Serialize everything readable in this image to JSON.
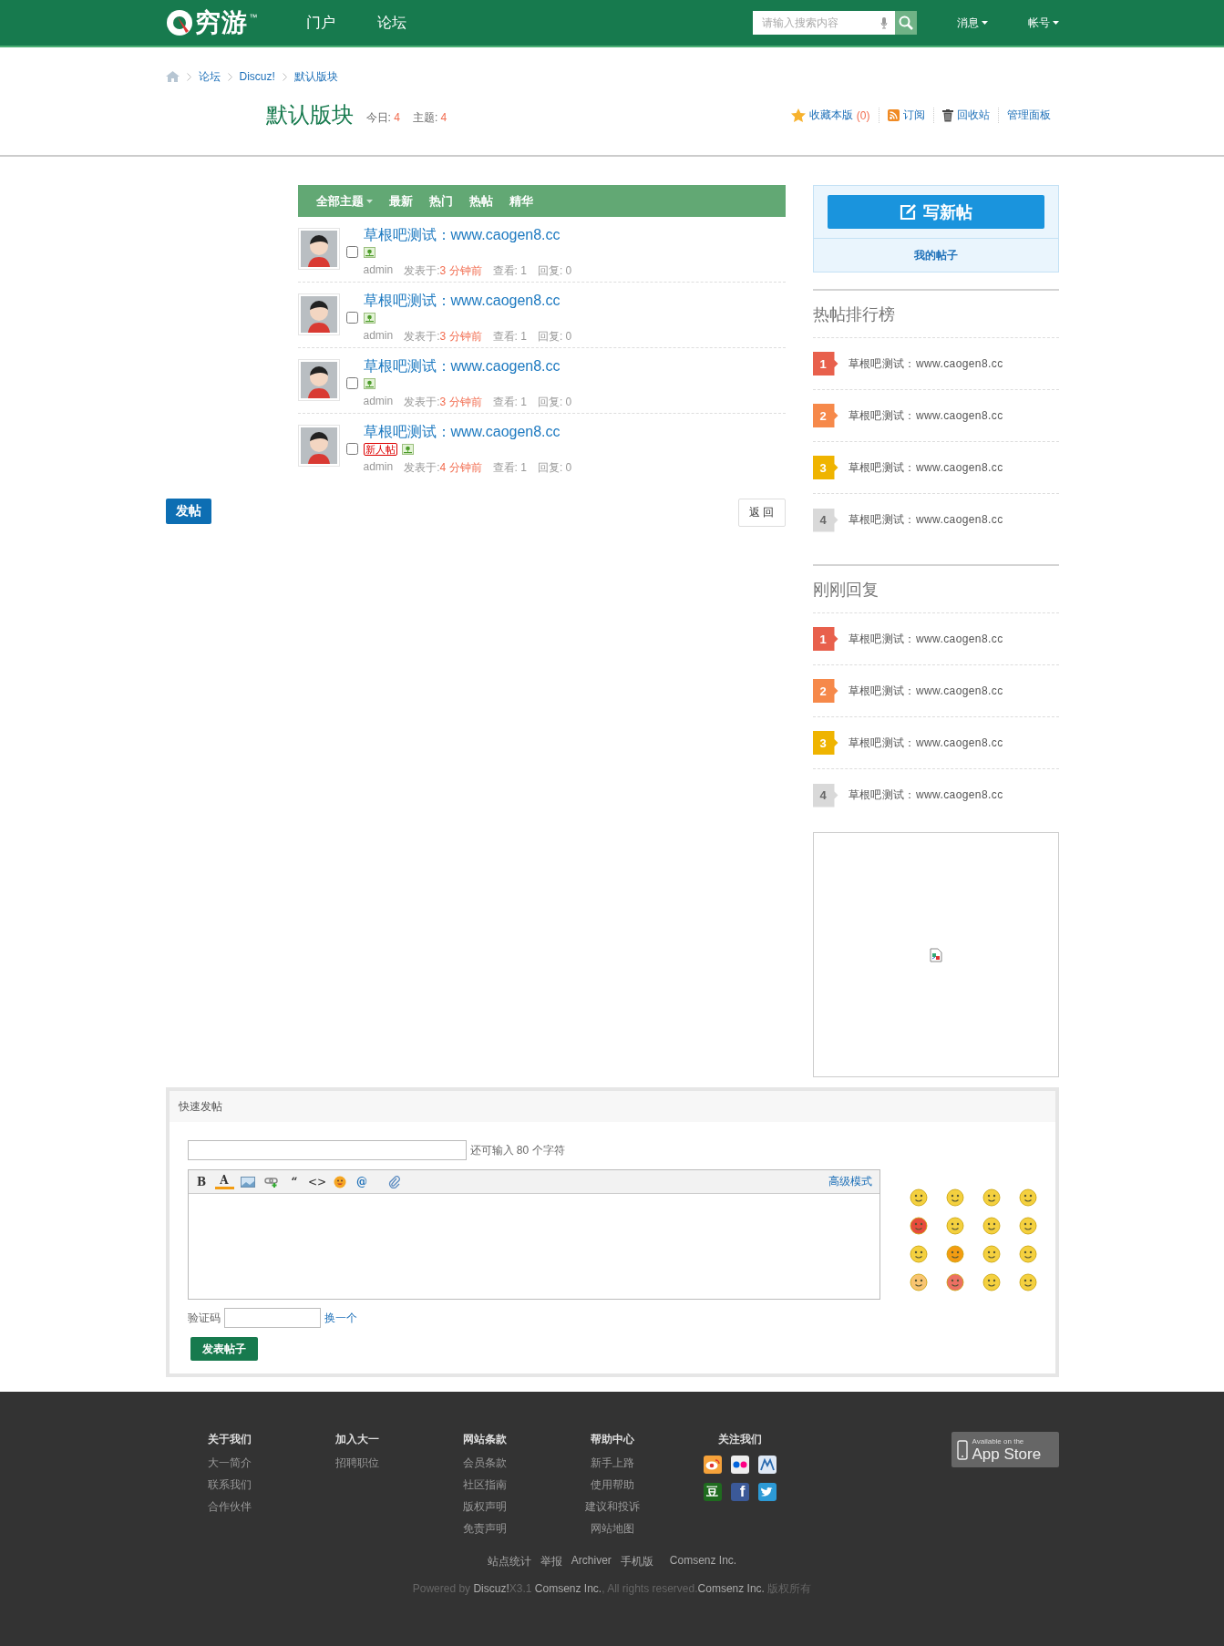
{
  "header": {
    "logo": "穷游",
    "logo_mark": "™",
    "nav": [
      "门户",
      "论坛"
    ],
    "search": {
      "placeholder": "请输入搜索内容"
    },
    "user_menu": [
      "消息",
      "帐号"
    ]
  },
  "breadcrumb": [
    "论坛",
    "Discuz!",
    "默认版块"
  ],
  "forum": {
    "title": "默认版块",
    "stats": [
      {
        "label": "今日:",
        "value": "4"
      },
      {
        "label": "主题:",
        "value": "4"
      }
    ],
    "actions": [
      {
        "kind": "favorite",
        "label": "收藏本版",
        "count": "(0)"
      },
      {
        "kind": "rss",
        "label": "订阅"
      },
      {
        "kind": "trash",
        "label": "回收站"
      },
      {
        "kind": "admin",
        "label": "管理面板"
      }
    ]
  },
  "filter_tabs": [
    {
      "label": "全部主题",
      "dropdown": true
    },
    {
      "label": "最新",
      "dropdown": false
    },
    {
      "label": "热门",
      "dropdown": false
    },
    {
      "label": "热帖",
      "dropdown": false
    },
    {
      "label": "精华",
      "dropdown": false
    }
  ],
  "threads": [
    {
      "title": "草根吧测试：www.caogen8.cc",
      "checked": false,
      "author": "admin",
      "posted_label": "发表于:",
      "posted": "3 分钟前",
      "views_label": "查看:",
      "views": "1",
      "replies_label": "回复:",
      "replies": "0"
    },
    {
      "title": "草根吧测试：www.caogen8.cc",
      "checked": false,
      "author": "admin",
      "posted_label": "发表于:",
      "posted": "3 分钟前",
      "views_label": "查看:",
      "views": "1",
      "replies_label": "回复:",
      "replies": "0"
    },
    {
      "title": "草根吧测试：www.caogen8.cc",
      "checked": false,
      "author": "admin",
      "posted_label": "发表于:",
      "posted": "3 分钟前",
      "views_label": "查看:",
      "views": "1",
      "replies_label": "回复:",
      "replies": "0"
    },
    {
      "title": "草根吧测试：www.caogen8.cc",
      "checked": false,
      "badge": "新人帖",
      "author": "admin",
      "posted_label": "发表于:",
      "posted": "4 分钟前",
      "views_label": "查看:",
      "views": "1",
      "replies_label": "回复:",
      "replies": "0"
    }
  ],
  "post_button": "发帖",
  "back_button": "返 回",
  "sidebar": {
    "new_post": "写新帖",
    "my_posts": "我的帖子",
    "lists": [
      {
        "title": "热帖排行榜",
        "items": [
          {
            "rank": "1",
            "color": "#e8604c",
            "text": "草根吧测试：www.caogen8.cc"
          },
          {
            "rank": "2",
            "color": "#f6894a",
            "text": "草根吧测试：www.caogen8.cc"
          },
          {
            "rank": "3",
            "color": "#efb400",
            "text": "草根吧测试：www.caogen8.cc"
          },
          {
            "rank": "4",
            "color": "#d9d9d9",
            "text": "草根吧测试：www.caogen8.cc"
          }
        ]
      },
      {
        "title": "刚刚回复",
        "items": [
          {
            "rank": "1",
            "color": "#e8604c",
            "text": "草根吧测试：www.caogen8.cc"
          },
          {
            "rank": "2",
            "color": "#f6894a",
            "text": "草根吧测试：www.caogen8.cc"
          },
          {
            "rank": "3",
            "color": "#efb400",
            "text": "草根吧测试：www.caogen8.cc"
          },
          {
            "rank": "4",
            "color": "#d9d9d9",
            "text": "草根吧测试：www.caogen8.cc"
          }
        ]
      }
    ]
  },
  "quick_post": {
    "title": "快速发帖",
    "subject_hint": "还可输入 80 个字符",
    "toolbar": [
      {
        "kind": "bold",
        "glyph": "B"
      },
      {
        "kind": "color",
        "glyph": "A"
      },
      {
        "kind": "image"
      },
      {
        "kind": "link"
      },
      {
        "kind": "quote",
        "glyph": "“"
      },
      {
        "kind": "code",
        "glyph": "<>"
      },
      {
        "kind": "smiley"
      },
      {
        "kind": "at",
        "glyph": "@"
      },
      {
        "kind": "attach"
      }
    ],
    "advanced_mode": "高级模式",
    "captcha_label": "验证码",
    "captcha_refresh": "换一个",
    "submit": "发表帖子"
  },
  "footer": {
    "columns": [
      {
        "title": "关于我们",
        "links": [
          "大一简介",
          "联系我们",
          "合作伙伴"
        ]
      },
      {
        "title": "加入大一",
        "links": [
          "招聘职位"
        ]
      },
      {
        "title": "网站条款",
        "links": [
          "会员条款",
          "社区指南",
          "版权声明",
          "免责声明"
        ]
      },
      {
        "title": "帮助中心",
        "links": [
          "新手上路",
          "使用帮助",
          "建议和投诉",
          "网站地图"
        ]
      }
    ],
    "follow": {
      "title": "关注我们",
      "icons": [
        {
          "kind": "weibo"
        },
        {
          "kind": "flickr"
        },
        {
          "kind": "people"
        },
        {
          "kind": "douban",
          "glyph": "豆"
        },
        {
          "kind": "facebook",
          "glyph": "f"
        },
        {
          "kind": "twitter"
        }
      ]
    },
    "app_store": {
      "small": "Available on the",
      "big": "App Store"
    },
    "links": [
      "站点统计",
      "举报",
      "Archiver",
      "手机版",
      "Comsenz Inc."
    ],
    "powered": [
      {
        "kind": "plain",
        "text": "Powered by "
      },
      {
        "kind": "link",
        "text": "Discuz!"
      },
      {
        "kind": "plain",
        "text": "X3.1 "
      },
      {
        "kind": "link",
        "text": "Comsenz Inc."
      },
      {
        "kind": "plain",
        "text": ", All rights reserved."
      },
      {
        "kind": "link",
        "text": "Comsenz Inc."
      },
      {
        "kind": "plain",
        "text": " 版权所有"
      }
    ]
  }
}
